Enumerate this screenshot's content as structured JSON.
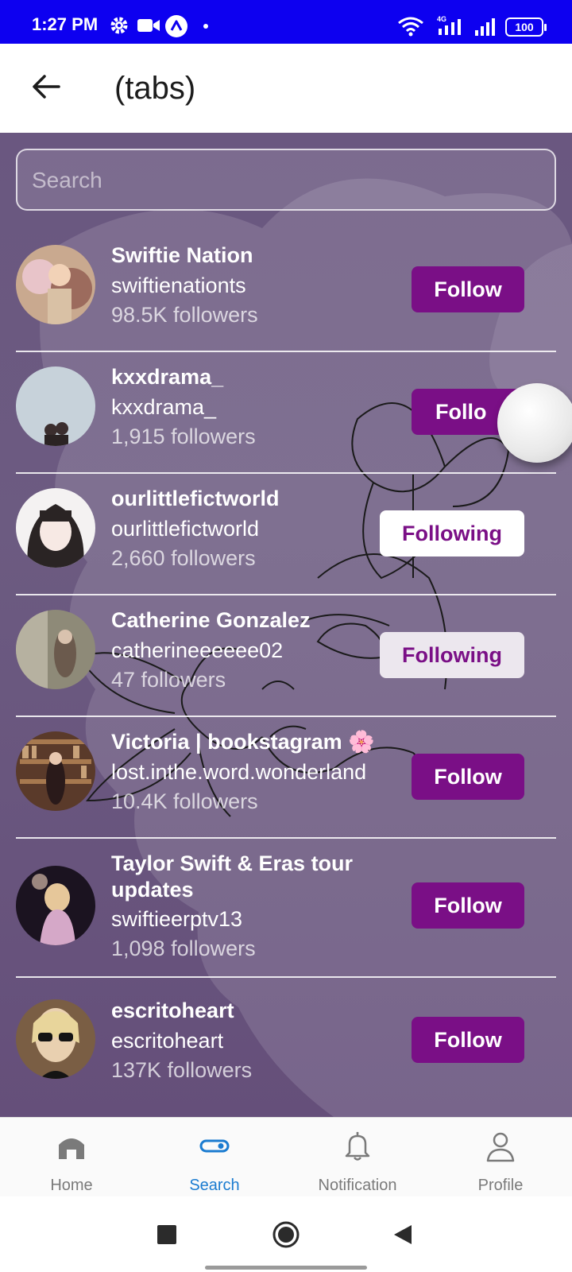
{
  "status_bar": {
    "time": "1:27 PM",
    "battery": "100",
    "network_label": "4G"
  },
  "header": {
    "title": "(tabs)"
  },
  "search": {
    "placeholder": "Search"
  },
  "users": [
    {
      "name": "Swiftie Nation",
      "handle": "swiftienationts",
      "followers": "98.5K followers",
      "button": "Follow",
      "following": false
    },
    {
      "name": "kxxdrama_",
      "handle": "kxxdrama_",
      "followers": "1,915 followers",
      "button": "Follo",
      "following": false
    },
    {
      "name": "ourlittlefictworld",
      "handle": "ourlittlefictworld",
      "followers": "2,660 followers",
      "button": "Following",
      "following": true
    },
    {
      "name": "Catherine Gonzalez",
      "handle": "catherineeeeee02",
      "followers": "47 followers",
      "button": "Following",
      "following": true
    },
    {
      "name": "Victoria | bookstagram 🌸",
      "handle": "lost.inthe.word.wonderland",
      "followers": "10.4K followers",
      "button": "Follow",
      "following": false
    },
    {
      "name": "Taylor Swift & Eras tour updates",
      "handle": "swiftieerptv13",
      "followers": "1,098 followers",
      "button": "Follow",
      "following": false
    },
    {
      "name": "escritoheart",
      "handle": "escritoheart",
      "followers": "137K followers",
      "button": "Follow",
      "following": false
    }
  ],
  "bottom_nav": [
    {
      "label": "Home",
      "icon": "home-icon",
      "active": false
    },
    {
      "label": "Search",
      "icon": "search-icon",
      "active": true
    },
    {
      "label": "Notification",
      "icon": "bell-icon",
      "active": false
    },
    {
      "label": "Profile",
      "icon": "person-icon",
      "active": false
    }
  ],
  "colors": {
    "status_bar": "#0d00f0",
    "follow_button": "#7a0f86",
    "active_tab": "#1a7bd0",
    "background": "#6a5780"
  }
}
